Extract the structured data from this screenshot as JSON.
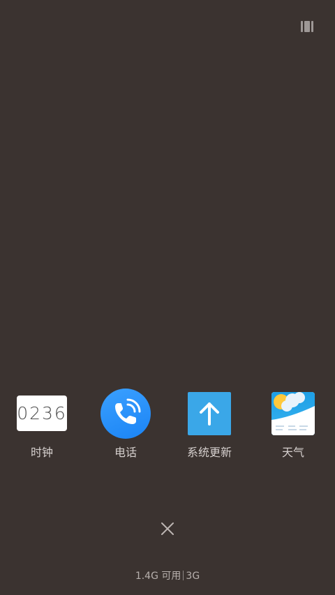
{
  "recents": {
    "apps": [
      {
        "label": "时钟",
        "icon": "clock-icon",
        "display": "0236"
      },
      {
        "label": "电话",
        "icon": "phone-icon"
      },
      {
        "label": "系统更新",
        "icon": "arrow-up-icon"
      },
      {
        "label": "天气",
        "icon": "weather-sun-cloud-icon"
      }
    ]
  },
  "memory": {
    "available": "1.4G 可用",
    "total": "3G"
  },
  "colors": {
    "background": "#3b3330",
    "phone_blue": "#1b84f5",
    "update_blue": "#3aa7e8",
    "sky_blue": "#2ba9e9"
  }
}
